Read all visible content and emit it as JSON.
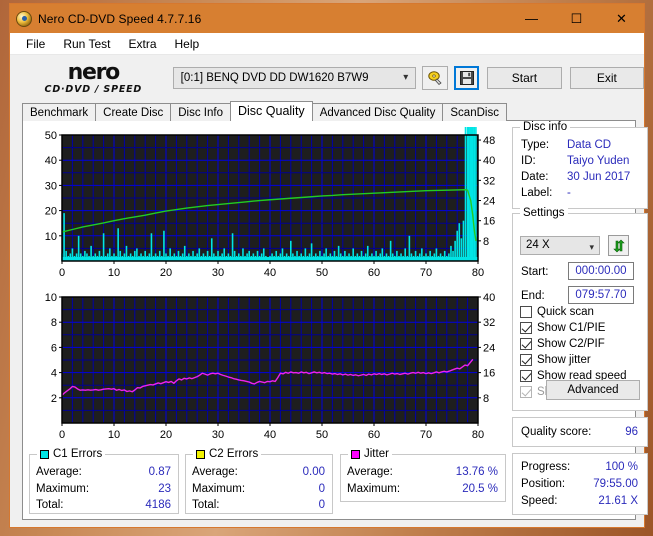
{
  "window": {
    "title": "Nero CD-DVD Speed 4.7.7.16",
    "icon": "nero-disc-icon",
    "minimize": "—",
    "maximize": "☐",
    "close": "✕"
  },
  "menu": {
    "items": [
      {
        "label": "File"
      },
      {
        "label": "Run Test"
      },
      {
        "label": "Extra"
      },
      {
        "label": "Help"
      }
    ]
  },
  "toolbar": {
    "logo_main": "nero",
    "logo_sub": "CD·DVD ∕ SPEED",
    "drive": "[0:1]   BENQ DVD DD DW1620 B7W9",
    "eject_icon": "eject-disc-icon",
    "save_icon": "floppy-save-icon",
    "start_label": "Start",
    "exit_label": "Exit"
  },
  "tabs": [
    {
      "label": "Benchmark",
      "active": false
    },
    {
      "label": "Create Disc",
      "active": false
    },
    {
      "label": "Disc Info",
      "active": false
    },
    {
      "label": "Disc Quality",
      "active": true
    },
    {
      "label": "Advanced Disc Quality",
      "active": false
    },
    {
      "label": "ScanDisc",
      "active": false
    }
  ],
  "disc_info": {
    "title": "Disc info",
    "rows": [
      {
        "label": "Type:",
        "value": "Data CD"
      },
      {
        "label": "ID:",
        "value": "Taiyo Yuden"
      },
      {
        "label": "Date:",
        "value": "30 Jun 2017"
      },
      {
        "label": "Label:",
        "value": "-"
      }
    ]
  },
  "settings": {
    "title": "Settings",
    "speed": "24 X",
    "refresh_icon": "refresh-icon",
    "start_label": "Start:",
    "start_value": "000:00.00",
    "end_label": "End:",
    "end_value": "079:57.70",
    "checkboxes": [
      {
        "label": "Quick scan",
        "checked": false,
        "disabled": false
      },
      {
        "label": "Show C1/PIE",
        "checked": true,
        "disabled": false
      },
      {
        "label": "Show C2/PIF",
        "checked": true,
        "disabled": false
      },
      {
        "label": "Show jitter",
        "checked": true,
        "disabled": false
      },
      {
        "label": "Show read speed",
        "checked": true,
        "disabled": false
      },
      {
        "label": "Show write speed",
        "checked": true,
        "disabled": true
      }
    ],
    "advanced_label": "Advanced"
  },
  "quality": {
    "label": "Quality score:",
    "value": "96"
  },
  "progress": {
    "rows": [
      {
        "label": "Progress:",
        "value": "100 %"
      },
      {
        "label": "Position:",
        "value": "79:55.00"
      },
      {
        "label": "Speed:",
        "value": "21.61 X"
      }
    ]
  },
  "stats": [
    {
      "title": "C1 Errors",
      "color": "#00e5e5",
      "rows": [
        {
          "label": "Average:",
          "value": "0.87"
        },
        {
          "label": "Maximum:",
          "value": "23"
        },
        {
          "label": "Total:",
          "value": "4186"
        }
      ]
    },
    {
      "title": "C2 Errors",
      "color": "#f2f200",
      "rows": [
        {
          "label": "Average:",
          "value": "0.00"
        },
        {
          "label": "Maximum:",
          "value": "0"
        },
        {
          "label": "Total:",
          "value": "0"
        }
      ]
    },
    {
      "title": "Jitter",
      "color": "#ff00ff",
      "rows": [
        {
          "label": "Average:",
          "value": "13.76 %"
        },
        {
          "label": "Maximum:",
          "value": "20.5 %"
        }
      ]
    }
  ],
  "chart_data": [
    {
      "id": "c1-errors-chart",
      "type": "area",
      "title": "C1 Errors / Read speed",
      "xlabel": "",
      "ylabel": "C1 errors",
      "y2label": "Read speed (X)",
      "xlim": [
        0,
        80
      ],
      "ylim": [
        0,
        50
      ],
      "y2lim": [
        0,
        50
      ],
      "xticks": [
        0,
        10,
        20,
        30,
        40,
        50,
        60,
        70,
        80
      ],
      "yticks": [
        10,
        20,
        30,
        40,
        50
      ],
      "y2ticks": [
        8,
        16,
        24,
        32,
        40,
        48
      ],
      "grid": true,
      "bg": "#1e1e1e",
      "grid_color": "#0000e0",
      "series": [
        {
          "name": "C1 Errors",
          "type": "area",
          "color": "#00e5e5",
          "x": [
            0,
            0.4,
            0.8,
            1.2,
            1.6,
            2,
            2.4,
            2.8,
            3.2,
            3.6,
            4,
            4.4,
            4.8,
            5.2,
            5.6,
            6,
            6.4,
            6.8,
            7.2,
            7.6,
            8,
            8.4,
            8.8,
            9.2,
            9.6,
            10,
            10.4,
            10.8,
            11.2,
            11.6,
            12,
            12.4,
            12.8,
            13.2,
            13.6,
            14,
            14.4,
            14.8,
            15.2,
            15.6,
            16,
            16.4,
            16.8,
            17.2,
            17.6,
            18,
            18.4,
            18.8,
            19.2,
            19.6,
            20,
            20.4,
            20.8,
            21.2,
            21.6,
            22,
            22.4,
            22.8,
            23.2,
            23.6,
            24,
            24.4,
            24.8,
            25.2,
            25.6,
            26,
            26.4,
            26.8,
            27.2,
            27.6,
            28,
            28.4,
            28.8,
            29.2,
            29.6,
            30,
            30.4,
            30.8,
            31.2,
            31.6,
            32,
            32.4,
            32.8,
            33.2,
            33.6,
            34,
            34.4,
            34.8,
            35.2,
            35.6,
            36,
            36.4,
            36.8,
            37.2,
            37.6,
            38,
            38.4,
            38.8,
            39.2,
            39.6,
            40,
            40.4,
            40.8,
            41.2,
            41.6,
            42,
            42.4,
            42.8,
            43.2,
            43.6,
            44,
            44.4,
            44.8,
            45.2,
            45.6,
            46,
            46.4,
            46.8,
            47.2,
            47.6,
            48,
            48.4,
            48.8,
            49.2,
            49.6,
            50,
            50.4,
            50.8,
            51.2,
            51.6,
            52,
            52.4,
            52.8,
            53.2,
            53.6,
            54,
            54.4,
            54.8,
            55.2,
            55.6,
            56,
            56.4,
            56.8,
            57.2,
            57.6,
            58,
            58.4,
            58.8,
            59.2,
            59.6,
            60,
            60.4,
            60.8,
            61.2,
            61.6,
            62,
            62.4,
            62.8,
            63.2,
            63.6,
            64,
            64.4,
            64.8,
            65.2,
            65.6,
            66,
            66.4,
            66.8,
            67.2,
            67.6,
            68,
            68.4,
            68.8,
            69.2,
            69.6,
            70,
            70.4,
            70.8,
            71.2,
            71.6,
            72,
            72.4,
            72.8,
            73.2,
            73.6,
            74,
            74.4,
            74.8,
            75.2,
            75.6,
            76,
            76.4,
            76.8,
            77.2,
            77.6,
            78,
            78.2,
            78.5,
            78.8,
            79,
            79.3,
            79.6
          ],
          "y": [
            3,
            19,
            4,
            2,
            3,
            5,
            2,
            3,
            10,
            3,
            2,
            4,
            3,
            2,
            6,
            2,
            3,
            2,
            4,
            2,
            11,
            2,
            3,
            5,
            2,
            3,
            2,
            13,
            4,
            2,
            3,
            6,
            2,
            3,
            2,
            4,
            5,
            2,
            3,
            2,
            4,
            2,
            3,
            11,
            2,
            3,
            2,
            4,
            2,
            12,
            3,
            2,
            5,
            2,
            3,
            2,
            4,
            2,
            3,
            6,
            2,
            3,
            2,
            4,
            2,
            3,
            5,
            2,
            3,
            2,
            4,
            2,
            9,
            3,
            2,
            4,
            2,
            3,
            5,
            2,
            3,
            2,
            11,
            4,
            2,
            3,
            2,
            5,
            2,
            3,
            4,
            2,
            3,
            2,
            4,
            2,
            3,
            5,
            2,
            1,
            2,
            3,
            2,
            4,
            2,
            3,
            5,
            2,
            3,
            2,
            8,
            3,
            2,
            4,
            2,
            3,
            2,
            5,
            2,
            3,
            7,
            2,
            3,
            2,
            4,
            2,
            3,
            5,
            2,
            3,
            2,
            4,
            2,
            6,
            3,
            2,
            4,
            2,
            3,
            2,
            5,
            2,
            3,
            2,
            4,
            2,
            3,
            6,
            2,
            3,
            2,
            4,
            2,
            3,
            5,
            2,
            3,
            2,
            8,
            3,
            2,
            4,
            2,
            3,
            2,
            5,
            2,
            10,
            3,
            2,
            4,
            2,
            3,
            5,
            2,
            3,
            2,
            4,
            2,
            3,
            5,
            2,
            3,
            2,
            4,
            2,
            3,
            6,
            4,
            8,
            12,
            15,
            9,
            16
          ]
        },
        {
          "name": "Read speed",
          "type": "line",
          "color": "#22cc22",
          "x": [
            0,
            2,
            4,
            6,
            8,
            10,
            12,
            14,
            16,
            18,
            20,
            22,
            24,
            26,
            28,
            30,
            32,
            34,
            36,
            38,
            40,
            42,
            44,
            46,
            48,
            50,
            52,
            54,
            56,
            58,
            60,
            62,
            64,
            66,
            68,
            70,
            72,
            74,
            76,
            77.5,
            78,
            78.6,
            79,
            79.3,
            79.6
          ],
          "y": [
            11.5,
            12.5,
            13.5,
            14.3,
            15.1,
            16,
            16.8,
            17.5,
            18.2,
            19,
            19.8,
            20.4,
            21,
            21.5,
            22,
            22.4,
            22.8,
            23.2,
            23.6,
            24,
            24.3,
            24.6,
            24.9,
            25.2,
            25.5,
            25.8,
            26,
            26.3,
            26.5,
            26.7,
            26.9,
            27.1,
            27.3,
            27.5,
            27.7,
            27.9,
            28,
            28.1,
            28.2,
            28.3,
            28.1,
            24,
            18,
            12,
            8
          ]
        },
        {
          "name": "C2 Errors",
          "type": "line",
          "color": "#f2f200",
          "x": [],
          "y": []
        }
      ]
    },
    {
      "id": "jitter-chart",
      "type": "line",
      "title": "Jitter",
      "xlabel": "",
      "ylabel": "",
      "y2label": "Jitter (%)",
      "xlim": [
        0,
        80
      ],
      "ylim": [
        0,
        10
      ],
      "y2lim": [
        0,
        40
      ],
      "xticks": [
        0,
        10,
        20,
        30,
        40,
        50,
        60,
        70,
        80
      ],
      "yticks": [
        2,
        4,
        6,
        8,
        10
      ],
      "y2ticks": [
        8,
        16,
        24,
        32,
        40
      ],
      "grid": true,
      "bg": "#1e1e1e",
      "grid_color": "#0000e0",
      "series": [
        {
          "name": "Jitter",
          "type": "line",
          "color": "#ee22ee",
          "x": [
            0,
            0.5,
            1,
            1.5,
            2,
            2.5,
            3,
            3.5,
            4,
            4.5,
            5,
            5.5,
            6,
            6.5,
            7,
            7.5,
            8,
            8.5,
            9,
            9.5,
            10,
            10.5,
            11,
            11.5,
            12,
            12.5,
            13,
            13.5,
            14,
            14.5,
            15,
            15.5,
            16,
            16.5,
            17,
            17.5,
            18,
            18.5,
            19,
            19.5,
            20,
            20.5,
            21,
            21.5,
            22,
            22.5,
            23,
            23.5,
            24,
            24.5,
            25,
            25.5,
            26,
            26.5,
            27,
            27.5,
            28,
            28.5,
            29,
            29.5,
            30,
            30.5,
            31,
            31.5,
            32,
            32.5,
            33,
            33.5,
            34,
            34.5,
            35,
            35.5,
            36,
            36.5,
            37,
            37.5,
            38,
            38.5,
            39,
            39.5,
            40,
            40.5,
            41,
            41.5,
            42,
            42.5,
            43,
            43.5,
            44,
            44.5,
            45,
            45.5,
            46,
            46.5,
            47,
            47.5,
            48,
            48.5,
            49,
            49.5,
            50,
            50.5,
            51,
            51.5,
            52,
            52.5,
            53,
            53.5,
            54,
            54.5,
            55,
            55.5,
            56,
            56.5,
            57,
            57.5,
            58,
            58.5,
            59,
            59.5,
            60,
            60.5,
            61,
            61.5,
            62,
            62.5,
            63,
            63.5,
            64,
            64.5,
            65,
            65.5,
            66,
            66.5,
            67,
            67.5,
            68,
            68.5,
            69,
            69.5,
            70,
            70.5,
            71,
            71.5,
            72,
            72.5,
            73,
            73.5,
            74,
            74.5,
            75,
            75.5,
            76,
            76.5,
            77,
            77.5,
            78,
            78.5,
            79,
            79.4
          ],
          "y": [
            2.2,
            2.4,
            2.55,
            2.7,
            2.9,
            2.85,
            2.7,
            2.6,
            2.62,
            2.6,
            2.63,
            2.6,
            2.62,
            2.65,
            2.6,
            2.63,
            2.68,
            2.7,
            2.72,
            2.68,
            2.72,
            2.6,
            2.66,
            2.58,
            2.62,
            2.5,
            2.55,
            2.48,
            2.62,
            2.8,
            2.78,
            2.9,
            2.95,
            3.0,
            3.05,
            3.02,
            3.1,
            3.18,
            3.12,
            3.2,
            3.28,
            3.22,
            3.3,
            3.15,
            3.35,
            3.5,
            3.42,
            3.55,
            3.5,
            3.58,
            3.52,
            3.6,
            3.68,
            3.8,
            3.95,
            3.88,
            3.8,
            3.9,
            3.95,
            3.9,
            3.95,
            3.85,
            3.78,
            3.72,
            3.65,
            3.6,
            3.52,
            3.48,
            3.42,
            3.38,
            3.35,
            3.3,
            3.25,
            3.15,
            3.1,
            3.22,
            3.3,
            3.25,
            3.2,
            3.3,
            3.28,
            3.35,
            3.3,
            3.6,
            3.95,
            3.9,
            4.02,
            3.95,
            4.05,
            3.98,
            4.0,
            3.95,
            4.05,
            3.98,
            4.02,
            3.92,
            3.98,
            4.05,
            3.98,
            4.02,
            3.95,
            4.0,
            3.92,
            3.95,
            3.88,
            3.92,
            3.85,
            3.9,
            3.82,
            3.88,
            3.8,
            3.85,
            3.78,
            3.82,
            3.75,
            3.8,
            3.85,
            3.78,
            3.88,
            3.82,
            3.9,
            3.85,
            3.92,
            3.85,
            3.9,
            3.82,
            3.88,
            3.95,
            3.88,
            3.92,
            3.85,
            3.9,
            3.95,
            3.88,
            3.95,
            4.0,
            3.95,
            4.02,
            3.95,
            4.0,
            3.92,
            3.98,
            3.92,
            3.98,
            4.05,
            3.98,
            4.05,
            4.1,
            4.05,
            4.12,
            4.2,
            4.28,
            4.35,
            4.3,
            4.45,
            4.6,
            4.55,
            4.8,
            5.05
          ]
        }
      ]
    }
  ]
}
